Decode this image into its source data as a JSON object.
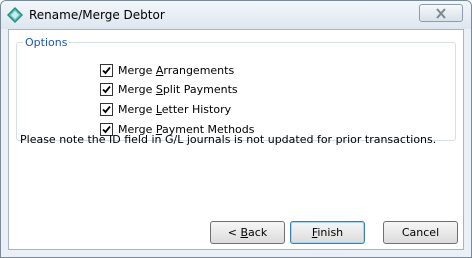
{
  "window": {
    "title": "Rename/Merge Debtor",
    "icon": "diamond-app-icon"
  },
  "options": {
    "legend": "Options",
    "items": [
      {
        "pre": "Merge ",
        "mnemonic": "A",
        "post": "rrangements",
        "checked": true
      },
      {
        "pre": "Merge ",
        "mnemonic": "S",
        "post": "plit Payments",
        "checked": true
      },
      {
        "pre": "Merge ",
        "mnemonic": "L",
        "post": "etter History",
        "checked": true
      },
      {
        "pre": "Merge ",
        "mnemonic": "P",
        "post": "ayment Methods",
        "checked": true
      }
    ]
  },
  "note": "Please note the ID field in G/L journals is not updated for prior transactions.",
  "buttons": {
    "back": {
      "pre": "< ",
      "mnemonic": "B",
      "post": "ack"
    },
    "finish": {
      "pre": "",
      "mnemonic": "F",
      "post": "inish"
    },
    "cancel": {
      "label": "Cancel"
    }
  }
}
